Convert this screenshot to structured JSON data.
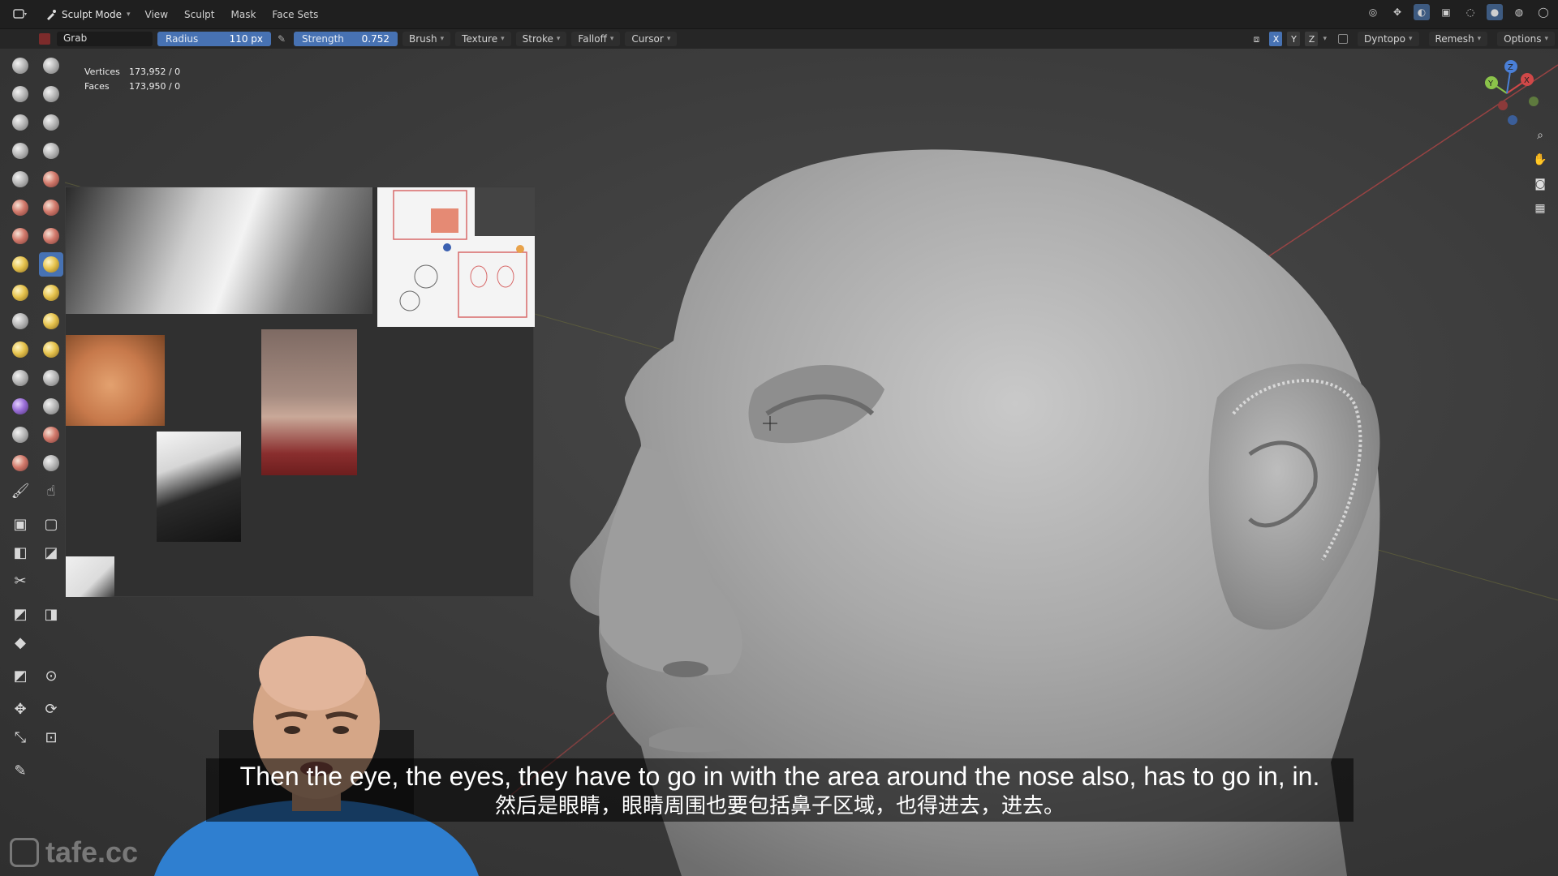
{
  "topbar": {
    "mode_label": "Sculpt Mode",
    "menus": [
      "View",
      "Sculpt",
      "Mask",
      "Face Sets"
    ]
  },
  "toolheader": {
    "brush_name": "Grab",
    "radius_label": "Radius",
    "radius_value": "110 px",
    "strength_label": "Strength",
    "strength_value": "0.752",
    "dropdowns": [
      "Brush",
      "Texture",
      "Stroke",
      "Falloff",
      "Cursor"
    ],
    "axes": [
      "X",
      "Y",
      "Z"
    ],
    "dyntopo_label": "Dyntopo",
    "remesh_label": "Remesh",
    "options_label": "Options"
  },
  "stats": {
    "vertices_label": "Vertices",
    "vertices_value": "173,952 / 0",
    "faces_label": "Faces",
    "faces_value": "173,950 / 0"
  },
  "gizmo": {
    "x_label": "X",
    "y_label": "Y",
    "z_label": "Z"
  },
  "subtitles": {
    "english": "Then the eye, the eyes, they have to go in with the area around the nose also, has to go in, in.",
    "chinese": "然后是眼睛，眼睛周围也要包括鼻子区域，也得进去，进去。"
  },
  "watermark": {
    "text": "tafe.cc"
  },
  "colors": {
    "accent": "#4772b3",
    "header_bg": "#1f1f1f",
    "viewport_bg": "#3a3a3a",
    "axis_x": "#d04848",
    "axis_y": "#8bc34a",
    "axis_z": "#4a7fd6"
  },
  "icons": {
    "navtools": [
      "zoom-icon",
      "hand-pan-icon",
      "camera-icon",
      "grid-view-icon"
    ]
  }
}
